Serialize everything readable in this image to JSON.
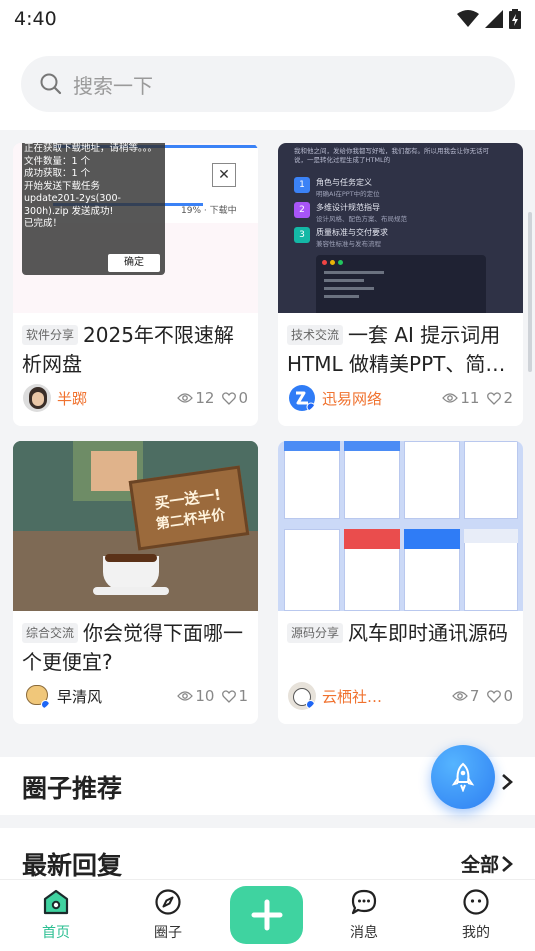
{
  "status": {
    "time": "4:40"
  },
  "search": {
    "placeholder": "搜索一下"
  },
  "cards": [
    {
      "tag": "软件分享",
      "title": "2025年不限速解析网盘",
      "author": "半踯",
      "views": "12",
      "likes": "0",
      "thumb": {
        "lines": [
          "正在获取下载地址，请稍等。。。",
          "文件数量：1 个",
          "成功获取：1 个",
          "开始发送下载任务",
          "update201-2ys(300-300h).zip 发送成功!",
          "已完成！"
        ],
        "file": "update201-2ys(300-300h).zip",
        "progress": "19% · 下载中",
        "ok": "确定",
        "close": "✕"
      }
    },
    {
      "tag": "技术交流",
      "title": "一套 AI 提示词用 HTML 做精美PPT、简…",
      "author": "迅易网络",
      "views": "11",
      "likes": "2",
      "thumb": {
        "header": "我和他之间，发给你我都写好啦，我们都有。所以用我会让你无话可说，一是转化过程生成了HTML的",
        "items": [
          "角色与任务定义",
          "多维设计规范指导",
          "质量标准与交付要求"
        ],
        "subs": [
          "明确AI在PPT中的定位",
          "设计风格、配色方案、布局规范",
          "兼容性标准与发布流程"
        ]
      }
    },
    {
      "tag": "综合交流",
      "title": "你会觉得下面哪一个更便宜?",
      "author": "早清风",
      "views": "10",
      "likes": "1",
      "thumb": {
        "sign_line1": "买一送一!",
        "sign_line2": "第二杯半价"
      }
    },
    {
      "tag": "源码分享",
      "title": "风车即时通讯源码",
      "author": "云栖社…",
      "views": "7",
      "likes": "0",
      "thumb": {}
    }
  ],
  "sections": {
    "circle": {
      "title": "圈子推荐",
      "more": ""
    },
    "replies": {
      "title": "最新回复",
      "more": "全部"
    }
  },
  "tabs": [
    {
      "label": "首页",
      "icon": "home-icon",
      "active": true
    },
    {
      "label": "圈子",
      "icon": "compass-icon",
      "active": false
    },
    {
      "label": "消息",
      "icon": "chat-icon",
      "active": false
    },
    {
      "label": "我的",
      "icon": "profile-icon",
      "active": false
    }
  ],
  "colors": {
    "accent": "#2bbf92",
    "plus": "#3fd3a0",
    "author_orange": "#f0722f",
    "fab": "#2e7ff2"
  }
}
